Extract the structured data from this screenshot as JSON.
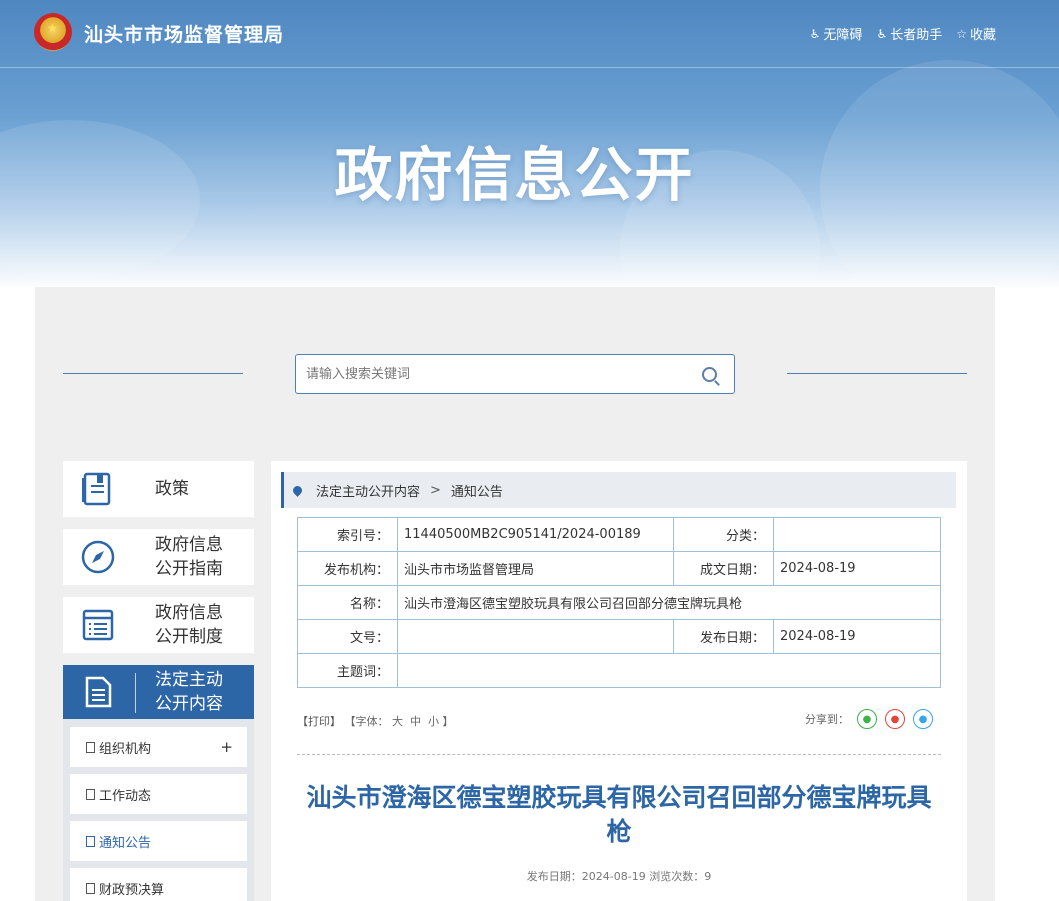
{
  "header": {
    "site_title": "汕头市市场监督管理局",
    "links": [
      {
        "icon": "accessibility-icon",
        "label": "无障碍"
      },
      {
        "icon": "elderly-assist-icon",
        "label": "长者助手"
      },
      {
        "icon": "star-icon",
        "label": "收藏"
      }
    ],
    "banner_title": "政府信息公开"
  },
  "search": {
    "placeholder": "请输入搜索关键词"
  },
  "sidebar": {
    "cards": [
      {
        "icon": "policy-book-icon",
        "label": "政策"
      },
      {
        "icon": "compass-icon",
        "label": "政府信息公开指南"
      },
      {
        "icon": "rules-list-icon",
        "label": "政府信息公开制度"
      },
      {
        "icon": "document-icon",
        "label": "法定主动公开内容"
      }
    ],
    "sub_items": [
      {
        "label": "组织机构",
        "expand": "+"
      },
      {
        "label": "工作动态"
      },
      {
        "label": "通知公告"
      },
      {
        "label": "财政预决算"
      }
    ]
  },
  "breadcrumb": {
    "items": [
      "法定主动公开内容",
      "通知公告"
    ],
    "separator": ">"
  },
  "meta_table": {
    "index_label": "索引号：",
    "index_value": "11440500MB2C905141/2024-00189",
    "category_label": "分类：",
    "category_value": "",
    "publisher_label": "发布机构：",
    "publisher_value": "汕头市市场监督管理局",
    "written_date_label": "成文日期：",
    "written_date_value": "2024-08-19",
    "name_label": "名称：",
    "name_value": "汕头市澄海区德宝塑胶玩具有限公司召回部分德宝牌玩具枪",
    "doc_no_label": "文号：",
    "doc_no_value": "",
    "publish_date_label": "发布日期：",
    "publish_date_value": "2024-08-19",
    "subject_label": "主题词：",
    "subject_value": ""
  },
  "tools": {
    "print": "【打印】",
    "font_prefix": "【字体：",
    "font_large": "大",
    "font_medium": "中",
    "font_small": "小",
    "font_suffix": "】",
    "share_label": "分享到：",
    "share_icons": [
      "wechat-icon",
      "weibo-icon",
      "qq-icon"
    ]
  },
  "article": {
    "title": "汕头市澄海区德宝塑胶玩具有限公司召回部分德宝牌玩具枪",
    "meta": "发布日期：2024-08-19  浏览次数：9"
  },
  "colors": {
    "primary": "#2d66a6",
    "panel_bg": "#efefef",
    "table_border": "#9fc0d9"
  }
}
